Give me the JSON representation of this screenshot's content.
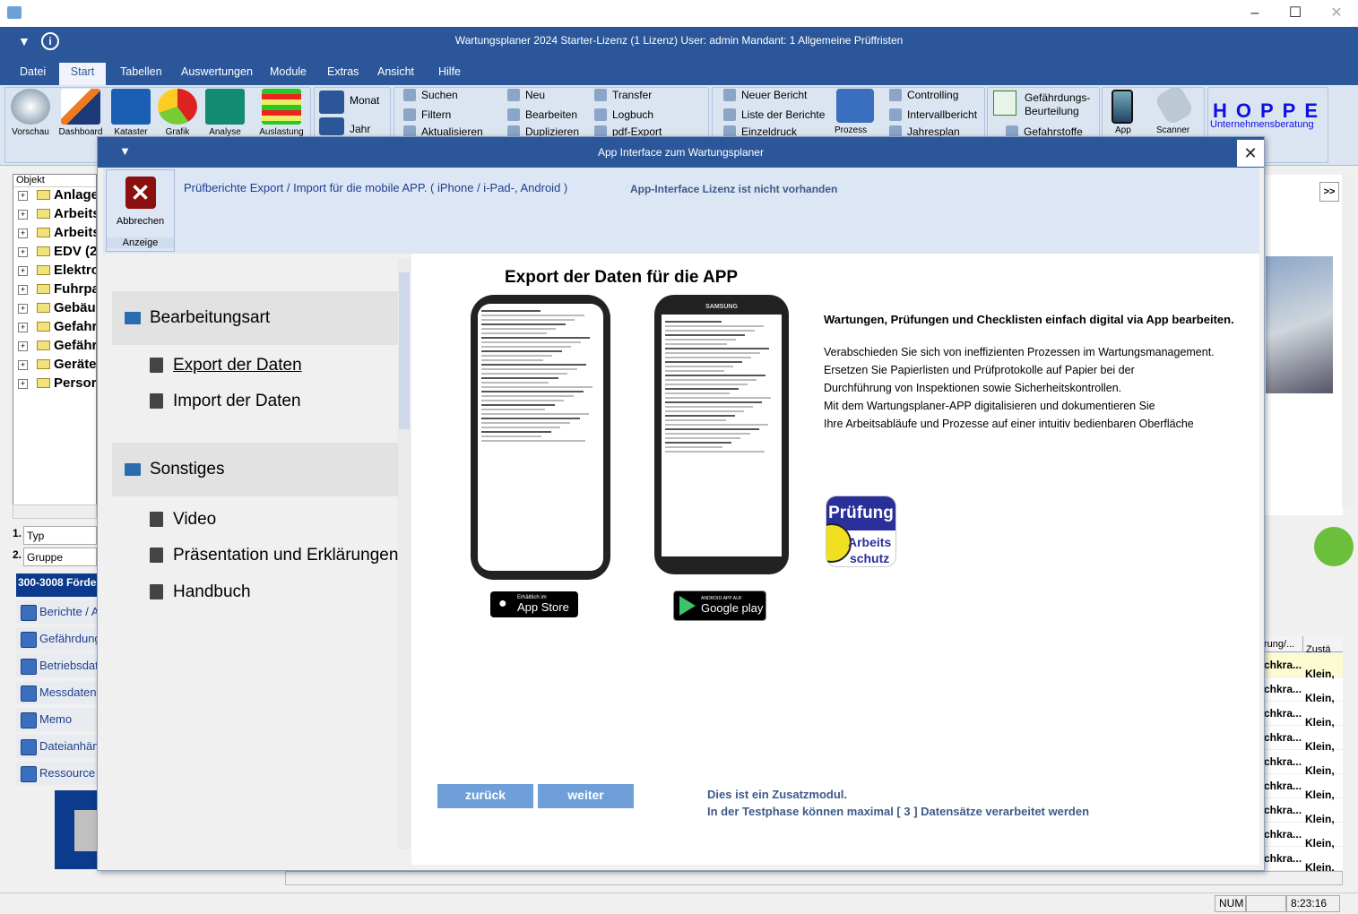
{
  "window": {
    "title": "Wartungsplaner 2024 Starter-Lizenz (1 Lizenz)   User: admin   Mandant: 1 Allgemeine Prüffristen"
  },
  "menu": [
    "Datei",
    "Start",
    "Tabellen",
    "Auswertungen",
    "Module",
    "Extras",
    "Ansicht",
    "Hilfe"
  ],
  "ribbon": {
    "big": [
      "Vorschau",
      "Dashboard",
      "Kataster",
      "Grafik",
      "Analyse",
      "Auslastung"
    ],
    "calendar": [
      "Monat",
      "Jahr"
    ],
    "small1": [
      "Suchen",
      "Filtern",
      "Aktualisieren"
    ],
    "small2": [
      "Neu",
      "Bearbeiten",
      "Duplizieren"
    ],
    "small3": [
      "Transfer",
      "Logbuch",
      "pdf-Export"
    ],
    "reports": [
      "Neuer Bericht",
      "Liste der Berichte",
      "Einzeldruck"
    ],
    "process": "Prozess",
    "controlling": [
      "Controlling",
      "Intervallbericht",
      "Jahresplan"
    ],
    "gbu": [
      "Gefährdungs-",
      "Beurteilung",
      "Gefahrstoffe"
    ],
    "app": [
      "App",
      "Scanner"
    ],
    "logo": {
      "name": "HOPPE",
      "sub": "Unternehmensberatung"
    }
  },
  "tree": {
    "header": "Objekt",
    "items": [
      "Anlage",
      "Arbeits",
      "Arbeits",
      "EDV (2",
      "Elektro",
      "Fuhrpa",
      "Gebäu",
      "Gefahr",
      "Gefähr",
      "Geräte",
      "Persor"
    ]
  },
  "filters": [
    {
      "num": "1.",
      "label": "Typ"
    },
    {
      "num": "2.",
      "label": "Gruppe"
    }
  ],
  "record": "300-3008 Förde",
  "leftbuttons": [
    "Berichte / A",
    "Gefährdung",
    "Betriebsdat",
    "Messdaten",
    "Memo",
    "Dateianhän",
    "Ressource"
  ],
  "dialog": {
    "title": "App Interface zum Wartungsplaner",
    "cancel": "Abbrechen",
    "group": "Anzeige",
    "subtitle": "Prüfberichte Export / Import für die mobile APP. ( iPhone / i-Pad-, Android )",
    "license": "App-Interface Lizenz ist nicht vorhanden",
    "nav": [
      {
        "head": "Bearbeitungsart",
        "items": [
          "Export der Daten",
          "Import  der Daten"
        ]
      },
      {
        "head": "Sonstiges",
        "items": [
          "Video",
          "Präsentation und Erklärungen",
          "Handbuch"
        ]
      }
    ],
    "content_title": "Export der Daten für die APP",
    "headline": "Wartungen, Prüfungen und Checklisten einfach digital via App bearbeiten.",
    "paragraph": [
      "Verabschieden Sie sich von ineffizienten Prozessen im Wartungsmanagement.",
      "Ersetzen Sie Papierlisten und Prüfprotokolle auf Papier bei der",
      "Durchführung von Inspektionen sowie Sicherheitskontrollen.",
      "Mit dem Wartungsplaner-APP digitalisieren und dokumentieren Sie",
      "Ihre Arbeitsabläufe und Prozesse auf einer intuitiv bedienbaren Oberfläche"
    ],
    "appstore": {
      "small": "Erhältlich im",
      "big": "App Store"
    },
    "googleplay": {
      "small": "ANDROID-APP AUF",
      "big": "Google play"
    },
    "phone_brand": "SAMSUNG",
    "badge": {
      "line1": "Prüfung",
      "line2": "Arbeits",
      "line3": "schutz"
    },
    "back": "zurück",
    "next": "weiter",
    "note1": "Dies ist ein Zusatzmodul.",
    "note2": "In der Testphase können maximal [ 3 ] Datensätze verarbeitet werden"
  },
  "right": {
    "more": ">>",
    "col1": "rung/...",
    "col2": "Zustä",
    "rows": [
      [
        "chkra...",
        "Klein,"
      ],
      [
        "chkra...",
        "Klein,"
      ],
      [
        "chkra...",
        "Klein,"
      ],
      [
        "chkra...",
        "Klein,"
      ],
      [
        "chkra...",
        "Klein,"
      ],
      [
        "chkra...",
        "Klein,"
      ],
      [
        "chkra...",
        "Klein,"
      ],
      [
        "chkra...",
        "Klein,"
      ],
      [
        "chkra...",
        "Klein,"
      ]
    ]
  },
  "status": {
    "num": "NUM",
    "time": "8:23:16"
  }
}
